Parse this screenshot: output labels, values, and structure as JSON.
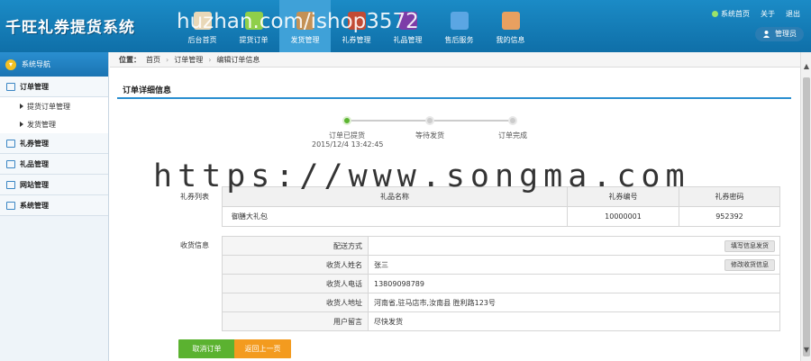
{
  "app": {
    "logo": "千旺礼券提货系统",
    "watermark_top": "huzhan.com/ishop3572"
  },
  "nav": [
    {
      "label": "后台首页",
      "color": "#e9d8b8"
    },
    {
      "label": "提货订单",
      "color": "#8fcf4a"
    },
    {
      "label": "发货管理",
      "color": "#c49155",
      "active": true
    },
    {
      "label": "礼券管理",
      "color": "#c24b35"
    },
    {
      "label": "礼品管理",
      "color": "#7d3da8"
    },
    {
      "label": "售后服务",
      "color": "#5ba6e3"
    },
    {
      "label": "我的信息",
      "color": "#e8a060"
    }
  ],
  "top_links": {
    "home": "系统首页",
    "about": "关于",
    "logout": "退出",
    "user": "管理员"
  },
  "sidebar": {
    "title": "系统导航",
    "groups": [
      {
        "label": "订单管理",
        "subs": [
          "提货订单管理",
          "发货管理"
        ]
      },
      {
        "label": "礼券管理"
      },
      {
        "label": "礼品管理"
      },
      {
        "label": "网站管理"
      },
      {
        "label": "系统管理"
      }
    ]
  },
  "breadcrumb": {
    "prefix": "位置：",
    "items": [
      "首页",
      "订单管理",
      "编辑订单信息"
    ]
  },
  "panel": {
    "title": "订单详细信息"
  },
  "steps": [
    {
      "label": "订单已提货",
      "time": "2015/12/4 13:42:45",
      "done": true
    },
    {
      "label": "等待发货",
      "done": false
    },
    {
      "label": "订单完成",
      "done": false
    }
  ],
  "watermark_big": "https://www.songma.com",
  "gift": {
    "side_label": "礼券列表",
    "headers": [
      "礼品名称",
      "礼券编号",
      "礼券密码"
    ],
    "rows": [
      [
        "御膳大礼包",
        "10000001",
        "952392"
      ]
    ]
  },
  "receiver": {
    "side_label": "收货信息",
    "rows": [
      {
        "key": "配送方式",
        "value": "",
        "button": "填写信息发货"
      },
      {
        "key": "收货人姓名",
        "value": "张三",
        "button": "修改收货信息"
      },
      {
        "key": "收货人电话",
        "value": "13809098789"
      },
      {
        "key": "收货人地址",
        "value": "河南省,驻马店市,汝南县 胜利路123号"
      },
      {
        "key": "用户留言",
        "value": "尽快发货"
      }
    ]
  },
  "buttons": {
    "cancel": "取消订单",
    "back": "返回上一页"
  }
}
